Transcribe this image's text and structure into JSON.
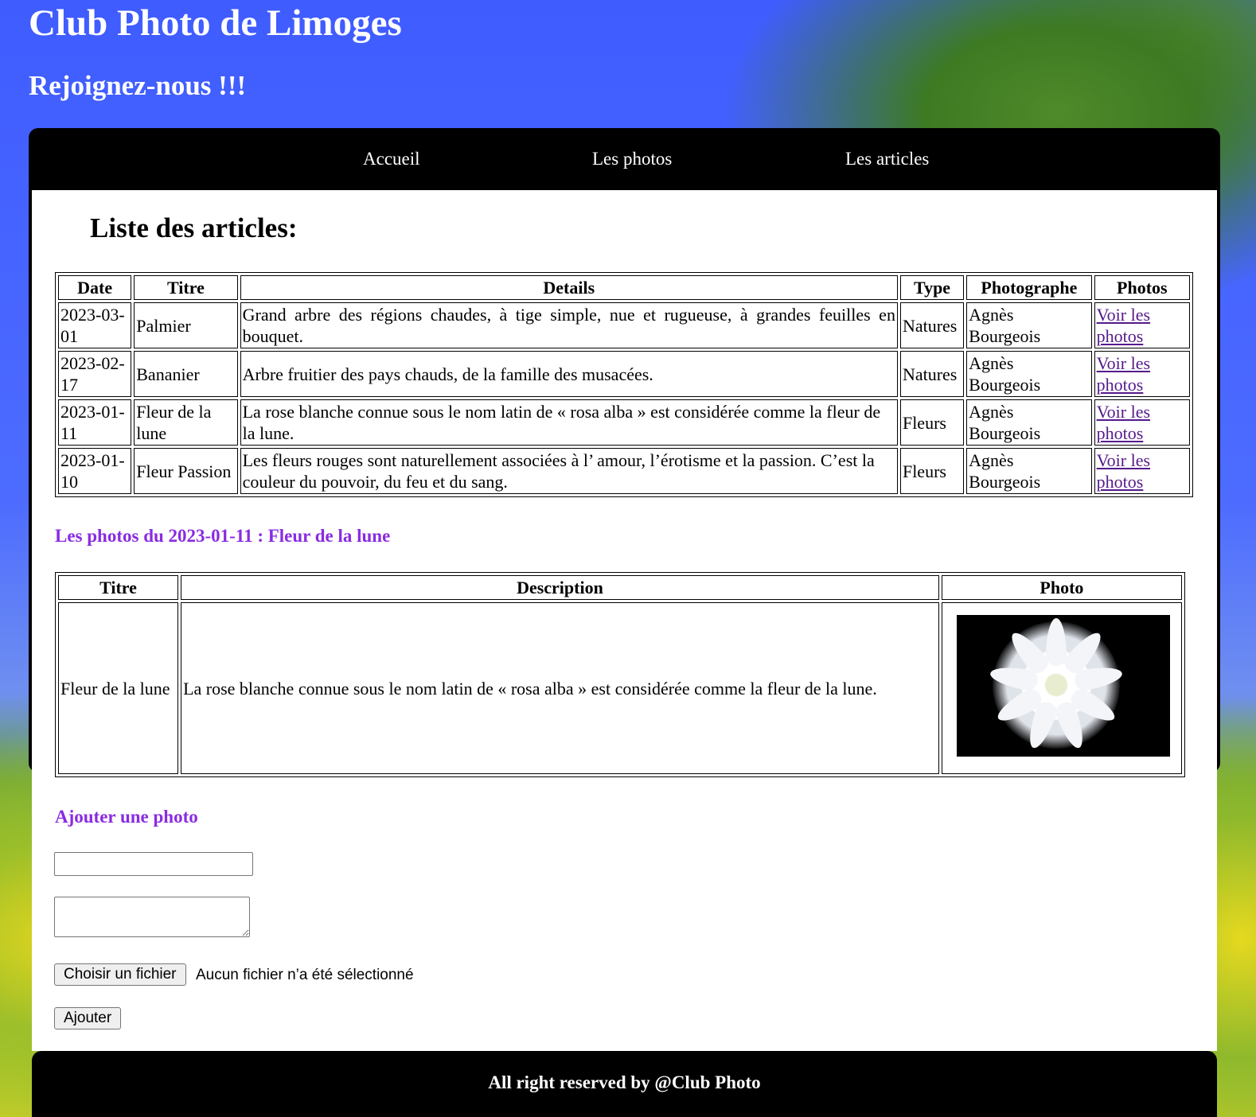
{
  "header": {
    "title": "Club Photo de Limoges",
    "subtitle": "Rejoignez-nous !!!"
  },
  "nav": {
    "items": [
      {
        "label": "Accueil"
      },
      {
        "label": "Les photos"
      },
      {
        "label": "Les articles"
      }
    ]
  },
  "main": {
    "title": "Liste des articles:",
    "articles": {
      "headers": [
        "Date",
        "Titre",
        "Details",
        "Type",
        "Photographe",
        "Photos"
      ],
      "rows": [
        {
          "date": "2023-03-01",
          "titre": "Palmier",
          "details": "Grand arbre des régions chaudes, à tige simple, nue et rugueuse, à grandes feuilles en bouquet.",
          "type": "Natures",
          "photographe": "Agnès Bourgeois",
          "link": "Voir les photos"
        },
        {
          "date": "2023-02-17",
          "titre": "Bananier",
          "details": "Arbre fruitier des pays chauds, de la famille des musacées.",
          "type": "Natures",
          "photographe": "Agnès Bourgeois",
          "link": "Voir les photos"
        },
        {
          "date": "2023-01-11",
          "titre": "Fleur de la lune",
          "details": "La rose blanche connue sous le nom latin de « rosa alba » est considérée comme la fleur de la lune.",
          "type": "Fleurs",
          "photographe": "Agnès Bourgeois",
          "link": "Voir les photos"
        },
        {
          "date": "2023-01-10",
          "titre": "Fleur Passion",
          "details": "Les fleurs rouges sont naturellement associées à l’ amour, l’érotisme et la passion. C’est la couleur du pouvoir, du feu et du sang.",
          "type": "Fleurs",
          "photographe": "Agnès Bourgeois",
          "link": "Voir les photos"
        }
      ]
    },
    "photos_section": {
      "title": "Les photos du 2023-01-11 : Fleur de la lune",
      "headers": [
        "Titre",
        "Description",
        "Photo"
      ],
      "rows": [
        {
          "titre": "Fleur de la lune",
          "description": "La rose blanche connue sous le nom latin de « rosa alba » est considérée comme la fleur de la lune.",
          "photo_icon": "white-flower-photo"
        }
      ]
    },
    "add_photo": {
      "title": "Ajouter une photo",
      "title_value": "",
      "description_value": "",
      "file_button": "Choisir un fichier",
      "file_status": "Aucun fichier n’a été sélectionné",
      "submit": "Ajouter"
    }
  },
  "footer": {
    "text": "All right reserved by @Club Photo"
  },
  "colors": {
    "nav_bg": "#000000",
    "section_title": "#8a2be2",
    "link": "#551a8b",
    "header_text": "#ffffff"
  }
}
